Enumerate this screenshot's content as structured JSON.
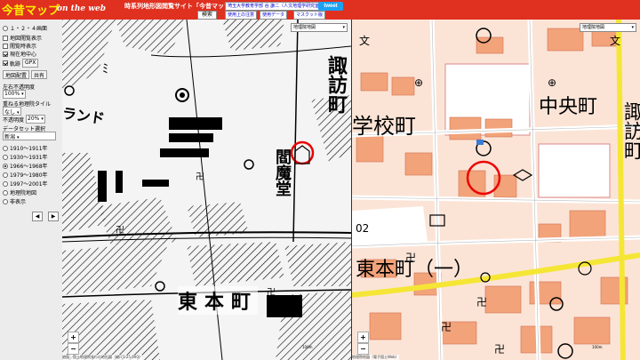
{
  "header": {
    "logo_main": "今昔マップ",
    "logo_sub": "on the web",
    "site_title": "時系列地形図閲覧サイト「今昔マップ on the web」",
    "search_label": "検索",
    "links": [
      "埼玉大学教育学部 谷 謙二（人文地理学研究室）",
      "使用上の注意",
      "使用データ",
      "マスクット版"
    ],
    "tweet_label": "tweet",
    "bg_color": "#e03020"
  },
  "sidebar": {
    "layout_label": "１・２・４画面",
    "options": [
      {
        "label": "地図閲覧表示",
        "checked": false
      },
      {
        "label": "閲覧時表示",
        "checked": false
      },
      {
        "label": "現在地中心",
        "checked": true
      }
    ],
    "trail_label": "軌跡",
    "gpx_label": "GPX",
    "btn_map_share": "地図配置",
    "btn_share": "共有",
    "opacity_label": "左右不透明度",
    "opacity_value": "100%",
    "overlay_label": "重ねる地理院タイル",
    "overlay_value": "なし",
    "transparency_label": "不透明度",
    "transparency_value": "20%",
    "dataset_label": "データセット選択",
    "dataset_value": "新潟",
    "periods": [
      {
        "label": "1910～1911年",
        "selected": false
      },
      {
        "label": "1930～1931年",
        "selected": false
      },
      {
        "label": "1966～1968年",
        "selected": true
      },
      {
        "label": "1979～1980年",
        "selected": false
      },
      {
        "label": "1997～2001年",
        "selected": false
      },
      {
        "label": "地理院地図",
        "selected": false
      },
      {
        "label": "非表示",
        "selected": false
      }
    ],
    "prev_label": "◀",
    "next_label": "▶"
  },
  "left_map": {
    "layer_select": "地理院地図",
    "labels": [
      "諏",
      "訪",
      "町",
      "閻",
      "魔",
      "堂",
      "東",
      "本",
      "町",
      "ランド"
    ],
    "scale_label": "100m",
    "attribution": "地図：国土地理院発行の地形図（縮尺1:25,000）"
  },
  "right_map": {
    "layer_select": "地理院地図",
    "labels": [
      "学校町",
      "中央町",
      "諏",
      "訪",
      "町",
      "東本町（一）",
      "02"
    ],
    "scale_label": "100m",
    "attribution": "地理院地図（電子国土Web）"
  },
  "colors": {
    "road_yellow": "#f5e636",
    "building_orange": "#f2a37a",
    "block_fill": "#fbe4d6"
  }
}
